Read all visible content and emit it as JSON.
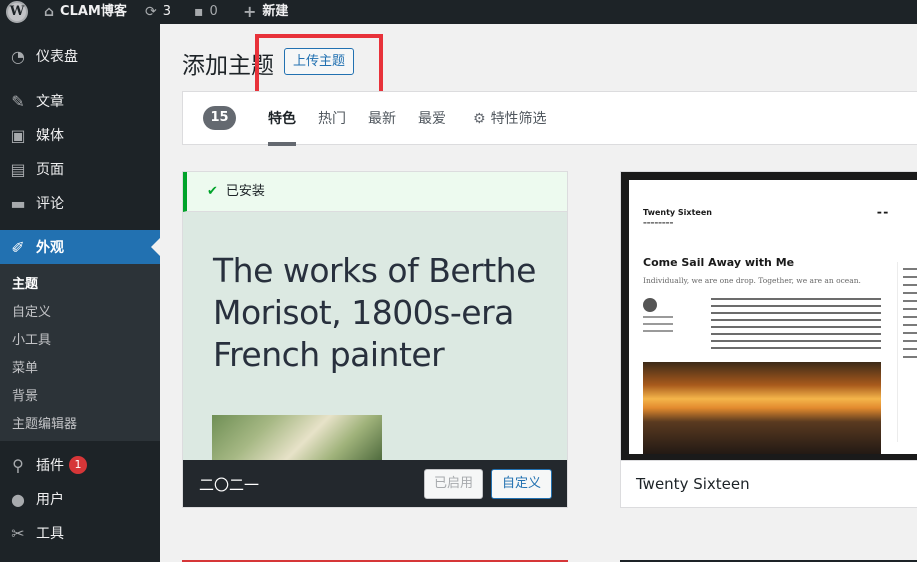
{
  "adminbar": {
    "site_name": "CLAM博客",
    "updates_count": "3",
    "comments_count": "0",
    "new_label": "新建"
  },
  "menu": {
    "items": [
      {
        "label": "仪表盘",
        "icon": "dashboard-icon"
      },
      {
        "label": "文章",
        "icon": "pin-icon"
      },
      {
        "label": "媒体",
        "icon": "media-icon"
      },
      {
        "label": "页面",
        "icon": "page-icon"
      },
      {
        "label": "评论",
        "icon": "comment-icon"
      },
      {
        "label": "外观",
        "icon": "appearance-icon"
      },
      {
        "label": "插件",
        "icon": "plugin-icon",
        "badge": "1"
      },
      {
        "label": "用户",
        "icon": "user-icon"
      },
      {
        "label": "工具",
        "icon": "tool-icon"
      }
    ],
    "submenu": [
      "主题",
      "自定义",
      "小工具",
      "菜单",
      "背景",
      "主题编辑器"
    ]
  },
  "page": {
    "title": "添加主题",
    "upload_button": "上传主题"
  },
  "filter": {
    "count": "15",
    "tabs": [
      "特色",
      "热门",
      "最新",
      "最爱"
    ],
    "feature_filter": "特性筛选"
  },
  "themes": [
    {
      "installed_label": "已安装",
      "screenshot_headline": "The works of Berthe Morisot, 1800s-era French painter",
      "name": "二〇二一",
      "activated_label": "已启用",
      "customize_label": "自定义"
    },
    {
      "name": "Twenty Sixteen",
      "screenshot_site_title": "Twenty Sixteen",
      "screenshot_post_title": "Come Sail Away with Me",
      "screenshot_post_subtitle": "Individually, we are one drop. Together, we are an ocean."
    }
  ],
  "colors": {
    "admin_dark": "#1d2327",
    "accent": "#2271b1",
    "highlight_box": "#e8323a",
    "installed_green": "#00a32a"
  }
}
